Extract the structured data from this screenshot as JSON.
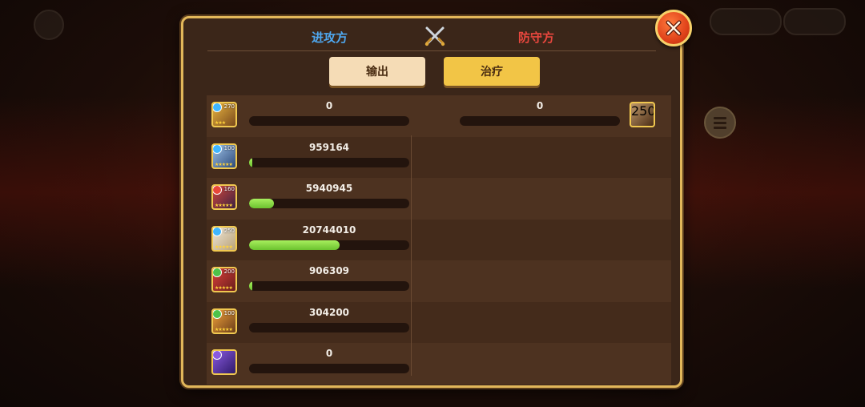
{
  "header": {
    "attacker_label": "进攻方",
    "defender_label": "防守方"
  },
  "tabs": [
    {
      "label": "输出",
      "selected": false
    },
    {
      "label": "治疗",
      "selected": true
    }
  ],
  "attacker_rows": [
    {
      "hero": "hero-1",
      "level": "270",
      "value": "0",
      "progress": 0,
      "colors": [
        "#e8b440",
        "#7a4a1c"
      ],
      "element_color": "#3fb6ff",
      "stars": "★★★"
    },
    {
      "hero": "hero-2",
      "level": "100",
      "value": "959164",
      "progress": 0.018,
      "colors": [
        "#9ec3e8",
        "#2d4a7a"
      ],
      "element_color": "#3fb6ff",
      "stars": "★★★★★"
    },
    {
      "hero": "hero-3",
      "level": "160",
      "value": "5940945",
      "progress": 0.155,
      "colors": [
        "#d4483c",
        "#3b2040"
      ],
      "element_color": "#e8473a",
      "stars": "★★★★★"
    },
    {
      "hero": "hero-4",
      "level": "250",
      "value": "20744010",
      "progress": 0.565,
      "colors": [
        "#efe6d8",
        "#b8a278"
      ],
      "element_color": "#3fb6ff",
      "stars": "★★★★★"
    },
    {
      "hero": "hero-5",
      "level": "200",
      "value": "906309",
      "progress": 0.018,
      "colors": [
        "#d9423a",
        "#6a1c1c"
      ],
      "element_color": "#4ec24a",
      "stars": "★★★★★"
    },
    {
      "hero": "hero-6",
      "level": "100",
      "value": "304200",
      "progress": 0,
      "colors": [
        "#f0a23a",
        "#6b3d1a"
      ],
      "element_color": "#4ec24a",
      "stars": "★★★★★"
    },
    {
      "hero": "hero-7",
      "level": "",
      "value": "0",
      "progress": 0,
      "colors": [
        "#8a5ae0",
        "#2e1a6a"
      ],
      "element_color": "#8a5ae0",
      "stars": ""
    }
  ],
  "defender_rows": [
    {
      "hero": "boss-1",
      "level": "250",
      "value": "0",
      "progress": 0,
      "colors": [
        "#c09a6a",
        "#4a2c16"
      ],
      "element_color": "#e8473a",
      "stars": ""
    }
  ],
  "colors": {
    "attacker": "#4fa8f0",
    "defender": "#e9473e",
    "bar_fill": "#7ed63a",
    "panel_border": "#e2b75a"
  },
  "icons": {
    "swords": "crossed-swords-icon",
    "close": "close-icon"
  }
}
